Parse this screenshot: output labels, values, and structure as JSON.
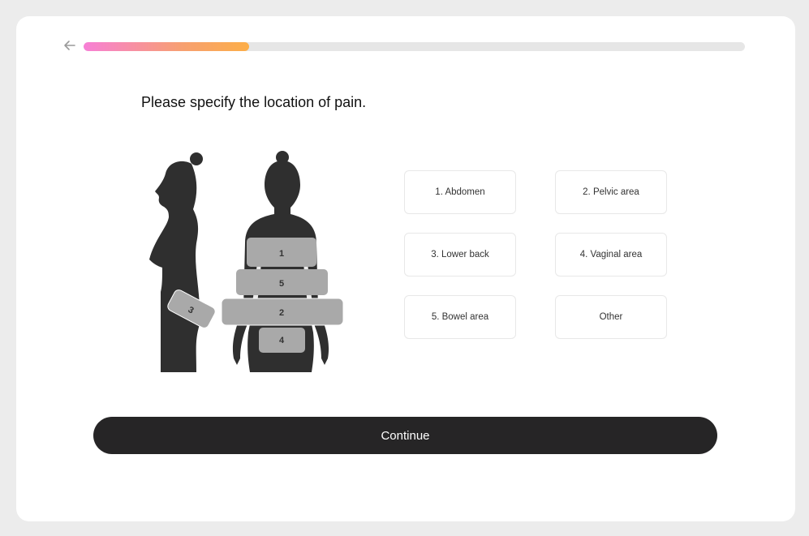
{
  "progress": {
    "value": 0.25,
    "gradient": [
      "#f77fd6",
      "#fcae48"
    ]
  },
  "question": "Please specify the location of pain.",
  "zones": {
    "z1": "1",
    "z2": "2",
    "z3": "3",
    "z4": "4",
    "z5": "5"
  },
  "options": [
    {
      "label": "1. Abdomen"
    },
    {
      "label": "2. Pelvic area"
    },
    {
      "label": "3. Lower back"
    },
    {
      "label": "4. Vaginal area"
    },
    {
      "label": "5. Bowel area"
    },
    {
      "label": "Other"
    }
  ],
  "continue_label": "Continue",
  "icons": {
    "back": "arrow-left-icon"
  },
  "colors": {
    "button": "#262526",
    "silhouette": "#2f2f2f",
    "zone": "#a9a9a9"
  }
}
